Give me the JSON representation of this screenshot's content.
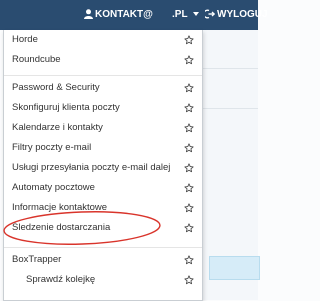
{
  "topbar": {
    "user_label": "KONTAKT@",
    "domain_label": ".PL",
    "logout_label": "WYLOGUJ"
  },
  "menu": {
    "group1": [
      {
        "label": "Horde"
      },
      {
        "label": "Roundcube"
      }
    ],
    "group2": [
      {
        "label": "Password & Security"
      },
      {
        "label": "Skonfiguruj klienta poczty"
      },
      {
        "label": "Kalendarze i kontakty"
      },
      {
        "label": "Filtry poczty e-mail"
      },
      {
        "label": "Usługi przesyłania poczty e-mail dalej"
      },
      {
        "label": "Automaty pocztowe"
      },
      {
        "label": "Informacje kontaktowe"
      },
      {
        "label": "Śledzenie dostarczania"
      }
    ],
    "group3": [
      {
        "label": "BoxTrapper"
      },
      {
        "label": "Sprawdź kolejkę"
      }
    ]
  },
  "colors": {
    "topbar": "#2a4c70",
    "annotation": "#d9342b"
  },
  "icons": [
    "user-icon",
    "chevron-down-icon",
    "logout-icon",
    "star-icon"
  ]
}
